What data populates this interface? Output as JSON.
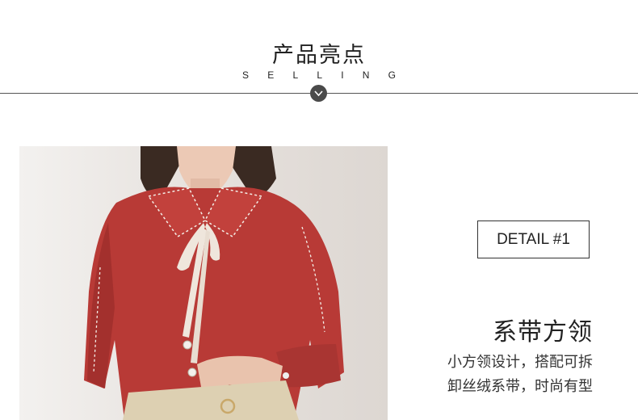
{
  "header": {
    "title": "产品亮点",
    "subtitle_letters": [
      "S",
      "E",
      "L",
      "L",
      "I",
      "N",
      "G"
    ]
  },
  "detail": {
    "badge": "DETAIL #1",
    "title": "系带方领",
    "description_lines": [
      "小方领设计，搭配可拆",
      "卸丝绒系带，时尚有型"
    ]
  },
  "icons": {
    "divider_marker": "chevron-down-icon"
  },
  "colors": {
    "shirt": "#b83a36",
    "divider": "#555555",
    "badge_border": "#333333"
  }
}
